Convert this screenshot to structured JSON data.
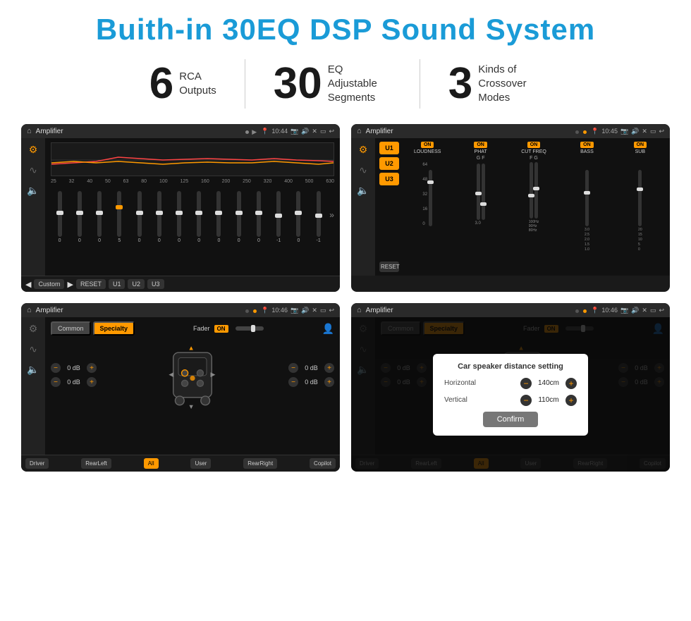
{
  "header": {
    "title": "Buith-in 30EQ DSP Sound System"
  },
  "stats": [
    {
      "number": "6",
      "label": "RCA\nOutputs"
    },
    {
      "number": "30",
      "label": "EQ Adjustable\nSegments"
    },
    {
      "number": "3",
      "label": "Kinds of\nCrossover Modes"
    }
  ],
  "screens": {
    "eq": {
      "title": "Amplifier",
      "time": "10:44",
      "frequencies": [
        "25",
        "32",
        "40",
        "50",
        "63",
        "80",
        "100",
        "125",
        "160",
        "200",
        "250",
        "320",
        "400",
        "500",
        "630"
      ],
      "values": [
        "0",
        "0",
        "0",
        "5",
        "0",
        "0",
        "0",
        "0",
        "0",
        "0",
        "0",
        "-1",
        "0",
        "-1"
      ],
      "buttons": [
        "Custom",
        "RESET",
        "U1",
        "U2",
        "U3"
      ]
    },
    "mixer": {
      "title": "Amplifier",
      "time": "10:45",
      "presets": [
        "U1",
        "U2",
        "U3"
      ],
      "channels": [
        {
          "name": "LOUDNESS",
          "toggle": "ON"
        },
        {
          "name": "PHAT",
          "toggle": "ON"
        },
        {
          "name": "CUT FREQ",
          "toggle": "ON"
        },
        {
          "name": "BASS",
          "toggle": "ON"
        },
        {
          "name": "SUB",
          "toggle": "ON"
        }
      ],
      "reset": "RESET"
    },
    "fader": {
      "title": "Amplifier",
      "time": "10:46",
      "tabs": [
        "Common",
        "Specialty"
      ],
      "activeTab": "Specialty",
      "faderLabel": "Fader",
      "faderOn": "ON",
      "leftValues": [
        "0 dB",
        "0 dB"
      ],
      "rightValues": [
        "0 dB",
        "0 dB"
      ],
      "positions": [
        "Driver",
        "RearLeft",
        "All",
        "User",
        "RearRight",
        "Copilot"
      ]
    },
    "dialog": {
      "title": "Amplifier",
      "time": "10:46",
      "dialogTitle": "Car speaker distance setting",
      "horizontal": {
        "label": "Horizontal",
        "value": "140cm"
      },
      "vertical": {
        "label": "Vertical",
        "value": "110cm"
      },
      "confirmLabel": "Confirm",
      "positions": [
        "Driver",
        "RearLeft",
        "All",
        "User",
        "RearRight",
        "Copilot"
      ]
    }
  }
}
